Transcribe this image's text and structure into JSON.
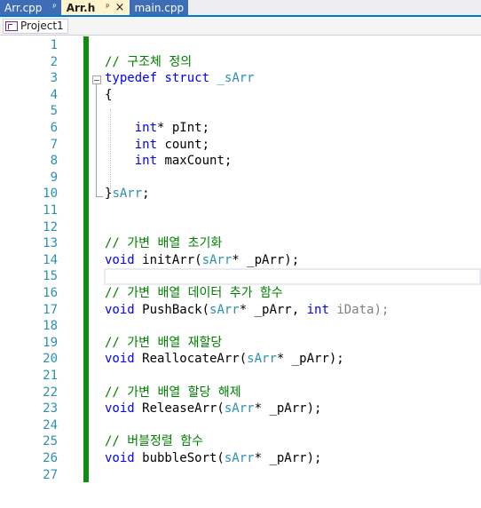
{
  "tabs": [
    {
      "label": "Arr.cpp",
      "pin": "ᵖ",
      "active": false
    },
    {
      "label": "Arr.h",
      "pin": "ᵖ",
      "close": "×",
      "active": true
    },
    {
      "label": "main.cpp",
      "active": false
    }
  ],
  "navbar": {
    "project": "Project1"
  },
  "editor": {
    "line_numbers": [
      "1",
      "2",
      "3",
      "4",
      "5",
      "6",
      "7",
      "8",
      "9",
      "10",
      "11",
      "12",
      "13",
      "14",
      "15",
      "16",
      "17",
      "18",
      "19",
      "20",
      "21",
      "22",
      "23",
      "24",
      "25",
      "26",
      "27"
    ],
    "code": {
      "l2": "// 구조체 정의",
      "l3_kw1": "typedef",
      "l3_kw2": "struct",
      "l3_ty": "_sArr",
      "l4": "{",
      "l6_kw": "int",
      "l6_rest": "* pInt;",
      "l7_kw": "int",
      "l7_rest": " count;",
      "l8_kw": "int",
      "l8_rest": " maxCount;",
      "l10_brace": "}",
      "l10_ty": "sArr",
      "l10_semi": ";",
      "l13": "// 가변 배열 초기화",
      "l14_kw": "void",
      "l14_fn": " initArr(",
      "l14_ty": "sArr",
      "l14_p": "* _pArr);",
      "l16": "// 가변 배열 데이터 추가 함수",
      "l17_kw": "void",
      "l17_fn": " PushBack(",
      "l17_ty": "sArr",
      "l17_p1": "* _pArr, ",
      "l17_kw2": "int",
      "l17_p2": " iData);",
      "l19": "// 가변 배열 재할당",
      "l20_kw": "void",
      "l20_fn": " ReallocateArr(",
      "l20_ty": "sArr",
      "l20_p": "* _pArr);",
      "l22": "// 가변 배열 할당 해제",
      "l23_kw": "void",
      "l23_fn": " ReleaseArr(",
      "l23_ty": "sArr",
      "l23_p": "* _pArr);",
      "l25": "// 버블정렬 함수",
      "l26_kw": "void",
      "l26_fn": " bubbleSort(",
      "l26_ty": "sArr",
      "l26_p": "* _pArr);"
    }
  },
  "colors": {
    "keyword": "#0000ff",
    "type": "#2b91af",
    "comment": "#008000",
    "line_number": "#2b91af",
    "change_bar": "#108c10",
    "active_tab": "#fff4cc",
    "inactive_tab": "#3e6db5"
  }
}
